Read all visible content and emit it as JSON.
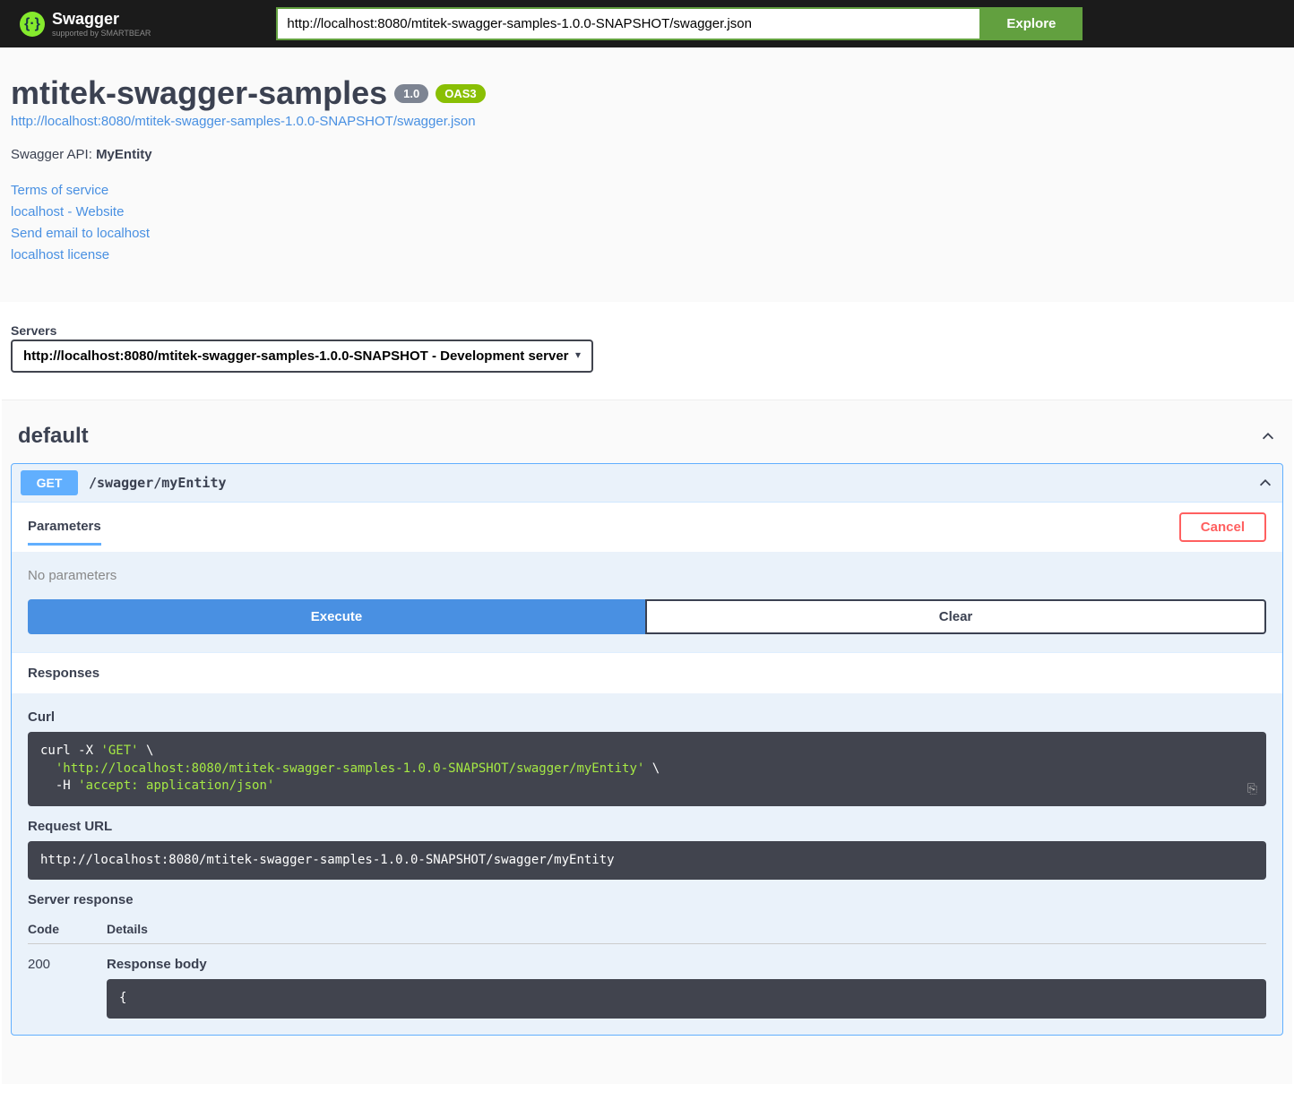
{
  "topbar": {
    "brand": "Swagger",
    "brand_sub": "supported by SMARTBEAR",
    "url_value": "http://localhost:8080/mtitek-swagger-samples-1.0.0-SNAPSHOT/swagger.json",
    "explore_label": "Explore"
  },
  "info": {
    "title": "mtitek-swagger-samples",
    "version": "1.0",
    "oas": "OAS3",
    "spec_url": "http://localhost:8080/mtitek-swagger-samples-1.0.0-SNAPSHOT/swagger.json",
    "desc_prefix": "Swagger API: ",
    "desc_bold": "MyEntity",
    "terms_label": "Terms of service",
    "website_label": "localhost - Website",
    "email_label": "Send email to localhost",
    "license_label": "localhost license"
  },
  "servers": {
    "label": "Servers",
    "selected": "http://localhost:8080/mtitek-swagger-samples-1.0.0-SNAPSHOT - Development server"
  },
  "tag": {
    "name": "default"
  },
  "operation": {
    "method": "GET",
    "path": "/swagger/myEntity",
    "parameters_label": "Parameters",
    "cancel_label": "Cancel",
    "no_params": "No parameters",
    "execute_label": "Execute",
    "clear_label": "Clear",
    "responses_label": "Responses",
    "curl_label": "Curl",
    "curl_text_pre": "curl -X ",
    "curl_get": "'GET'",
    "curl_slash": " \\",
    "curl_url": "'http://localhost:8080/mtitek-swagger-samples-1.0.0-SNAPSHOT/swagger/myEntity'",
    "curl_h": "  -H ",
    "curl_accept": "'accept: application/json'",
    "request_url_label": "Request URL",
    "request_url": "http://localhost:8080/mtitek-swagger-samples-1.0.0-SNAPSHOT/swagger/myEntity",
    "server_response_label": "Server response",
    "code_header": "Code",
    "details_header": "Details",
    "status_code": "200",
    "response_body_label": "Response body",
    "response_body": "{"
  }
}
